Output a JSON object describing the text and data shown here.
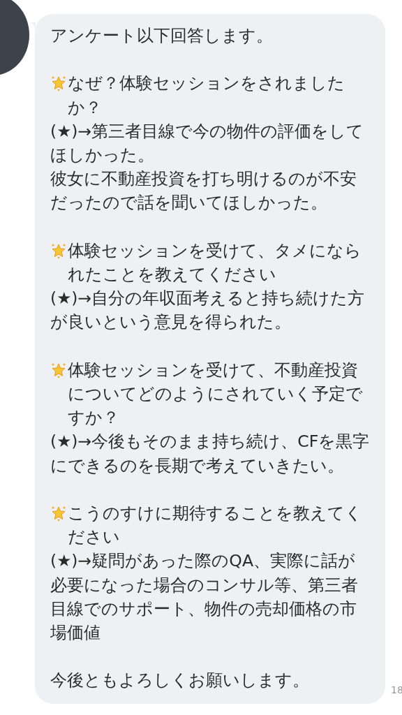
{
  "message": {
    "greeting": "アンケート以下回答します。",
    "items": [
      {
        "question": "なぜ？体験セッションをされましたか？",
        "answer": [
          "(★)→第三者目線で今の物件の評価をしてほしかった。",
          "彼女に不動産投資を打ち明けるのが不安だったので話を聞いてほしかった。"
        ]
      },
      {
        "question": "体験セッションを受けて、タメになられたことを教えてください",
        "answer": [
          "(★)→自分の年収面考えると持ち続けた方が良いという意見を得られた。"
        ]
      },
      {
        "question": "体験セッションを受けて、不動産投資についてどのようにされていく予定ですか？",
        "answer": [
          "(★)→今後もそのまま持ち続け、CFを黒字にできるのを長期で考えていきたい。"
        ]
      },
      {
        "question": "こうのすけに期待することを教えてください",
        "answer": [
          "(★)→疑問があった際のQA、実際に話が必要になった場合のコンサル等、第三者目線でのサポート、物件の売却価格の市場価値"
        ]
      }
    ],
    "closing": "今後ともよろしくお願いします。",
    "time": "18"
  }
}
